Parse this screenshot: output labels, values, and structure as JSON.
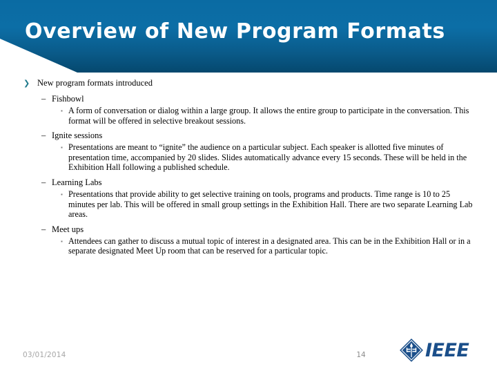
{
  "slide": {
    "title": "Overview of New Program Formats",
    "colors": {
      "header_top": "#0a6ba3",
      "header_bottom": "#05486e",
      "level1_bullet": "#1f7a8c",
      "level3_bullet": "#808080",
      "ieee_blue": "#1b4f8a",
      "footer_text": "#a6a6a6"
    }
  },
  "bullets": {
    "level1_marker": "❯",
    "level2_marker": "–",
    "level3_marker": "▪",
    "items": [
      {
        "level": 1,
        "text": "New program formats introduced"
      },
      {
        "level": 2,
        "text": "Fishbowl"
      },
      {
        "level": 3,
        "text": "A form of conversation or dialog within a large group. It allows the entire group to participate in the conversation.  This format will be offered in selective breakout sessions."
      },
      {
        "level": 2,
        "text": "Ignite sessions"
      },
      {
        "level": 3,
        "text": "Presentations are meant to “ignite” the audience on a particular subject. Each speaker is allotted five minutes of presentation time, accompanied by 20 slides. Slides automatically advance every 15 seconds.  These will be held in the Exhibition Hall following a published schedule."
      },
      {
        "level": 2,
        "text": "Learning Labs"
      },
      {
        "level": 3,
        "text": "Presentations that provide ability to get selective training on tools, programs and products.  Time range is 10 to 25 minutes per lab.  This will be offered in small group settings in the Exhibition Hall.  There are two separate Learning Lab areas."
      },
      {
        "level": 2,
        "text": "Meet ups"
      },
      {
        "level": 3,
        "text": "Attendees can gather to discuss a mutual topic of interest in a designated area.  This can be in the Exhibition Hall or in a separate designated Meet Up room that can be reserved for a particular topic."
      }
    ]
  },
  "footer": {
    "date": "03/01/2014",
    "page_number": "14",
    "logo_text": "IEEE"
  }
}
